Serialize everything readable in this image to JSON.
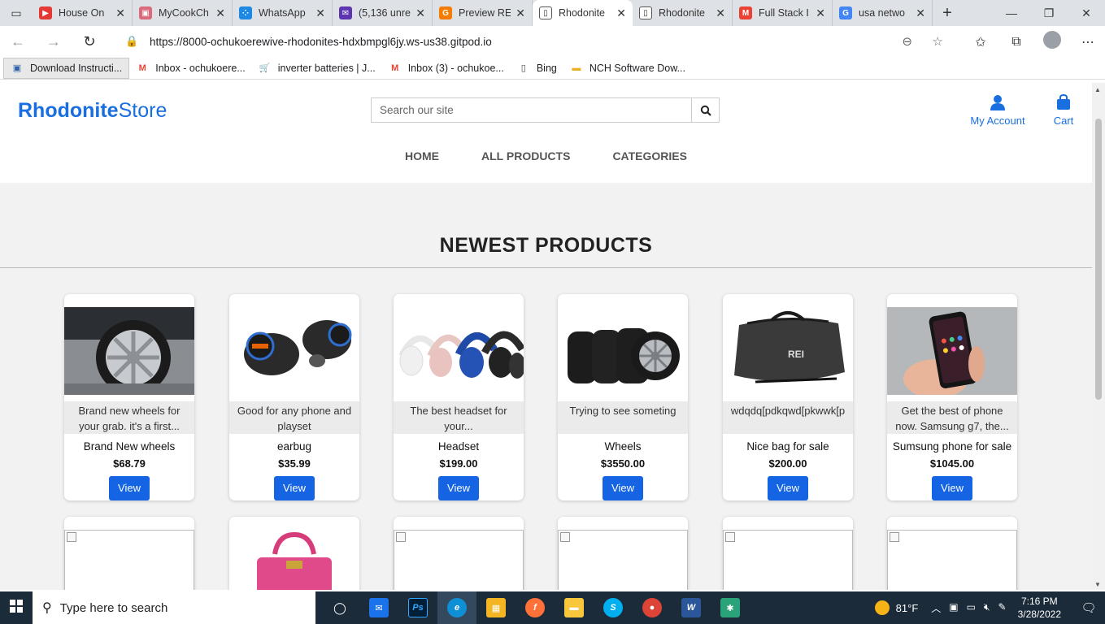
{
  "browser": {
    "tabs": [
      {
        "title": "House On",
        "color": "#e53935",
        "glyph": "▶"
      },
      {
        "title": "MyCookCh",
        "color": "#d96b7c",
        "glyph": "▣"
      },
      {
        "title": "WhatsApp",
        "color": "#1e88e5",
        "glyph": "⁘"
      },
      {
        "title": "(5,136 unre",
        "color": "#5e35b1",
        "glyph": "✉"
      },
      {
        "title": "Preview RE",
        "color": "#f57c00",
        "glyph": "G"
      },
      {
        "title": "Rhodonite",
        "color": "#ffffff",
        "glyph": "▯",
        "active": true
      },
      {
        "title": "Rhodonite",
        "color": "#ffffff",
        "glyph": "▯"
      },
      {
        "title": "Full Stack I",
        "color": "#ea4335",
        "glyph": "M"
      },
      {
        "title": "usa netwo",
        "color": "#4285f4",
        "glyph": "G"
      }
    ],
    "url": "https://8000-ochukoerewive-rhodonites-hdxbmpgl6jy.ws-us38.gitpod.io",
    "bookmarks": [
      {
        "label": "Download Instructi...",
        "icon": "bookmark-doc-icon",
        "glyph": "▣",
        "color": "#2d5fa8"
      },
      {
        "label": "Inbox - ochukoere...",
        "icon": "gmail-icon",
        "glyph": "M",
        "color": "#ea4335"
      },
      {
        "label": "inverter batteries | J...",
        "icon": "cart-icon",
        "glyph": "🛒",
        "color": "#444"
      },
      {
        "label": "Inbox (3) - ochukoe...",
        "icon": "gmail-icon",
        "glyph": "M",
        "color": "#ea4335"
      },
      {
        "label": "Bing",
        "icon": "page-icon",
        "glyph": "▯",
        "color": "#444"
      },
      {
        "label": "NCH Software Dow...",
        "icon": "folder-icon",
        "glyph": "▬",
        "color": "#e8b022"
      }
    ]
  },
  "site": {
    "logo_part1": "Rhodonite",
    "logo_part2": "Store",
    "search_placeholder": "Search our site",
    "account_label": "My Account",
    "cart_label": "Cart",
    "menu": [
      "HOME",
      "ALL PRODUCTS",
      "CATEGORIES"
    ],
    "section_title": "NEWEST PRODUCTS",
    "view_label": "View",
    "products": [
      {
        "description": "Brand new wheels for your grab. it's a first...",
        "name": "Brand New wheels",
        "price": "$68.79",
        "image": "car-wheel-image"
      },
      {
        "description": "Good for any phone and playset",
        "name": "earbug",
        "price": "$35.99",
        "image": "earbuds-image"
      },
      {
        "description": "The best headset for your...",
        "name": "Headset",
        "price": "$199.00",
        "image": "headphones-image"
      },
      {
        "description": "Trying to see someting",
        "name": "Wheels",
        "price": "$3550.00",
        "image": "tires-image"
      },
      {
        "description": "wdqdq[pdkqwd[pkwwk[p",
        "name": "Nice bag for sale",
        "price": "$200.00",
        "image": "duffel-bag-image"
      },
      {
        "description": "Get the best of phone now. Samsung g7, the...",
        "name": "Sumsung phone for sale",
        "price": "$1045.00",
        "image": "phone-image"
      }
    ]
  },
  "taskbar": {
    "search_placeholder": "Type here to search",
    "temperature": "81°F",
    "time": "7:16 PM",
    "date": "3/28/2022"
  },
  "colors": {
    "brand": "#1a6fe0",
    "button": "#1464e4",
    "page_bg": "#f2f2f2"
  }
}
